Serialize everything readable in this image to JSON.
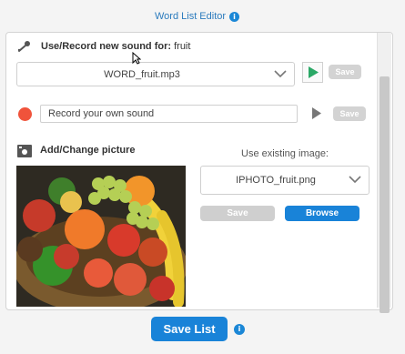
{
  "header": {
    "title": "Word List Editor",
    "info_icon": "info-icon"
  },
  "sound": {
    "label_bold": "Use/Record new sound for:",
    "label_word": "fruit",
    "selected_file": "WORD_fruit.mp3",
    "save_label": "Save",
    "record_placeholder": "Record your own sound",
    "record_save_label": "Save",
    "icons": {
      "mic": "microphone-icon",
      "play": "play-icon",
      "record": "record-icon"
    }
  },
  "picture": {
    "label": "Add/Change picture",
    "existing_label": "Use existing image:",
    "selected_image": "IPHOTO_fruit.png",
    "save_label": "Save",
    "browse_label": "Browse",
    "icon": "picture-icon"
  },
  "footer": {
    "save_list_label": "Save List",
    "info_icon": "info-icon"
  },
  "colors": {
    "accent": "#1983d8",
    "play_green": "#2aa866",
    "record_red": "#f0533b",
    "disabled": "#d3d3d3"
  }
}
